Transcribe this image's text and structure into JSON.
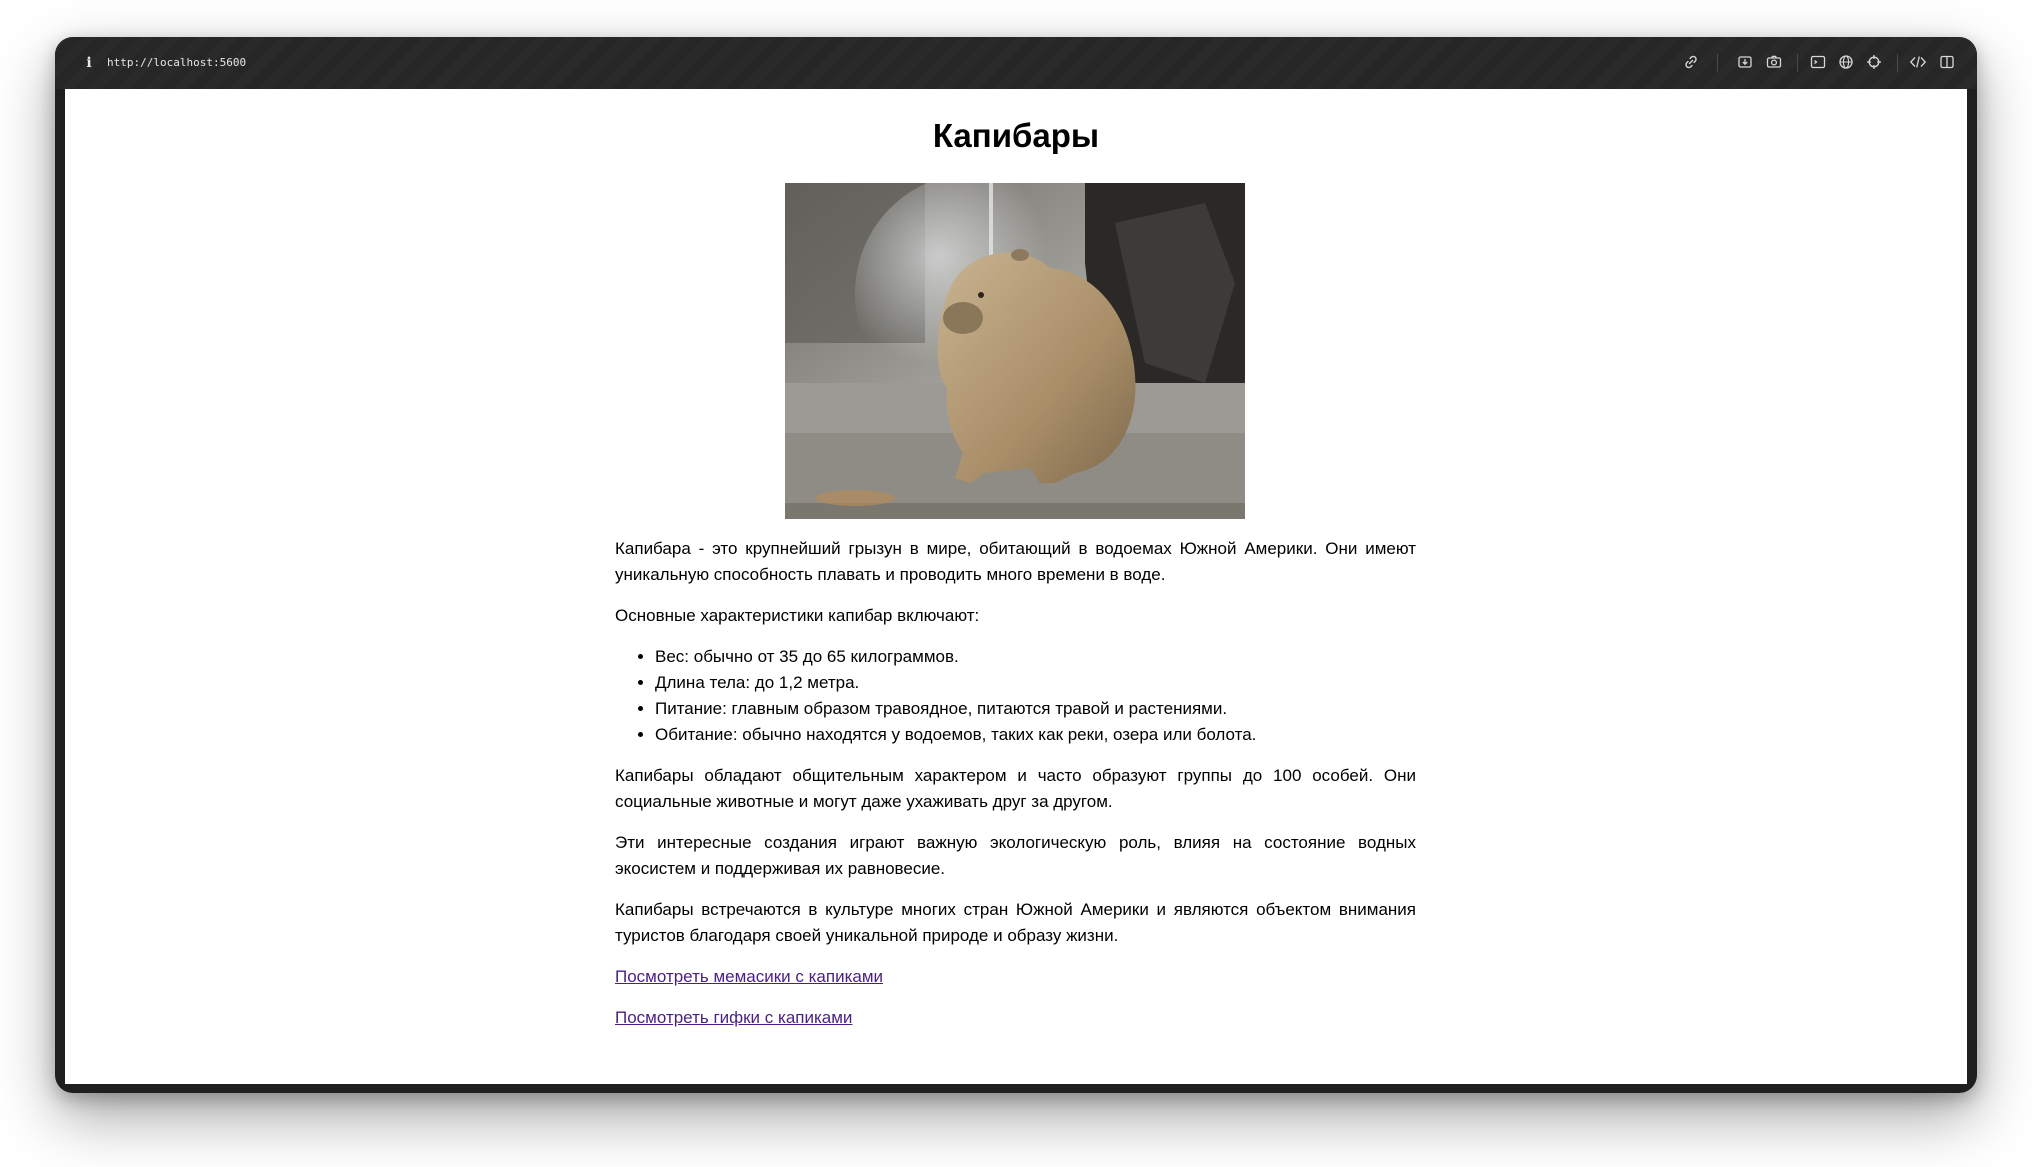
{
  "browser": {
    "url": "http://localhost:5600",
    "info_glyph": "i",
    "toolbar_icons": [
      "link-icon",
      "download-icon",
      "camera-icon",
      "terminal-icon",
      "globe-icon",
      "crosshair-icon",
      "code-icon",
      "sidebar-icon"
    ]
  },
  "page": {
    "title": "Капибары",
    "image_icon": "capybara-photo",
    "intro": "Капибара - это крупнейший грызун в мире, обитающий в водоемах Южной Америки. Они имеют уникальную способность плавать и проводить много времени в воде.",
    "features_heading": "Основные характеристики капибар включают:",
    "features": [
      "Вес: обычно от 35 до 65 килограммов.",
      "Длина тела: до 1,2 метра.",
      "Питание: главным образом травоядное, питаются травой и растениями.",
      "Обитание: обычно находятся у водоемов, таких как реки, озера или болота."
    ],
    "paragraph_social": "Капибары обладают общительным характером и часто образуют группы до 100 особей. Они социальные животные и могут даже ухаживать друг за другом.",
    "paragraph_ecology": "Эти интересные создания играют важную экологическую роль, влияя на состояние водных экосистем и поддерживая их равновесие.",
    "paragraph_culture": "Капибары встречаются в культуре многих стран Южной Америки и являются объектом внимания туристов благодаря своей уникальной природе и образу жизни.",
    "link_memes": "Посмотреть мемасики с капиками",
    "link_gifs": "Посмотреть гифки с капиками"
  },
  "colors": {
    "link_visited": "#4b1f84",
    "toolbar_bg": "#2a2a2a"
  }
}
